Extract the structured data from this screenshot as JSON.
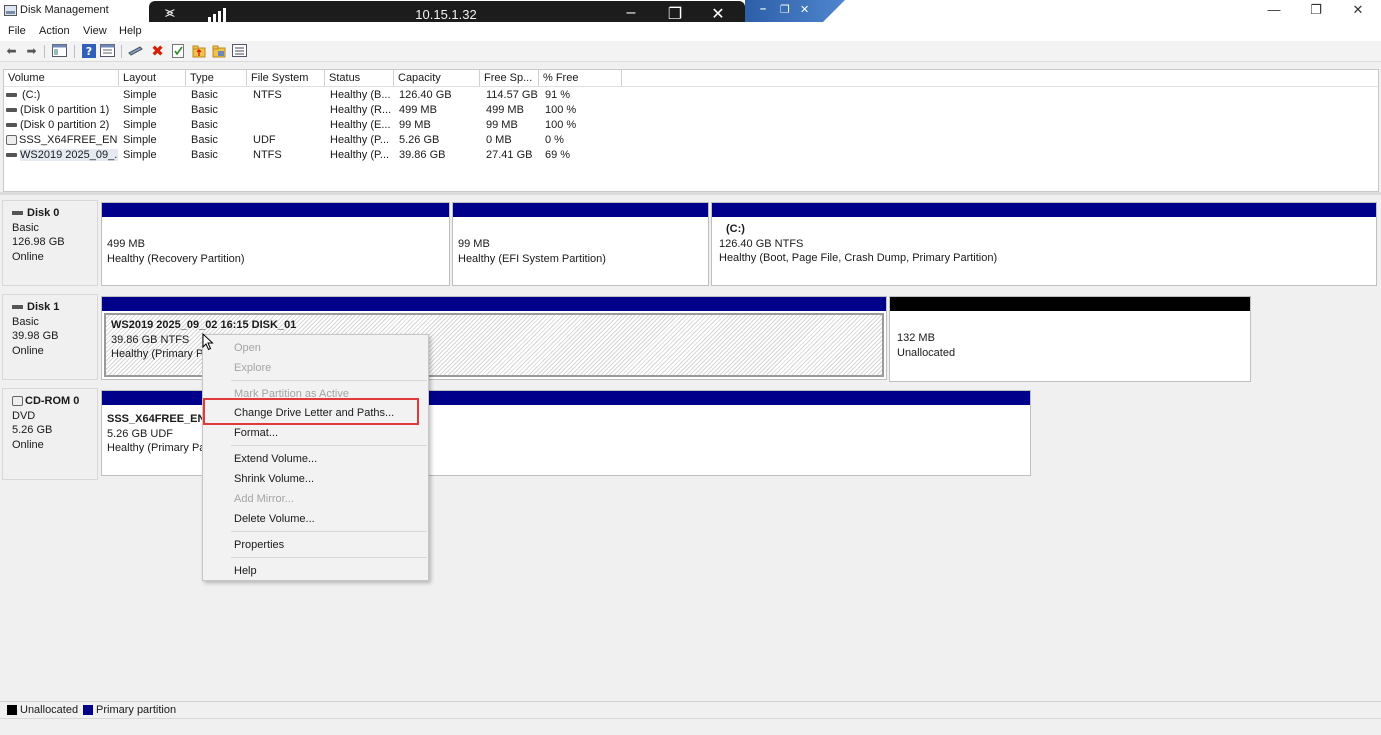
{
  "window": {
    "title": "Disk Management",
    "minimize": "—",
    "maximize": "❐",
    "close": "✕"
  },
  "remote_bar": {
    "ip": "10.15.1.32",
    "pin_glyph": "⪤",
    "minimize": "–",
    "restore": "❐",
    "close": "✕"
  },
  "inner_caption": {
    "minimize": "–",
    "restore": "❐",
    "close": "✕"
  },
  "menu": [
    "File",
    "Action",
    "View",
    "Help"
  ],
  "toolbar": {
    "back": "⬅",
    "forward": "➡",
    "delete": "✖"
  },
  "volume_list": {
    "columns": [
      "Volume",
      "Layout",
      "Type",
      "File System",
      "Status",
      "Capacity",
      "Free Sp...",
      "% Free"
    ],
    "rows": [
      [
        "(C:)",
        "Simple",
        "Basic",
        "NTFS",
        "Healthy (B...",
        "126.40 GB",
        "114.57 GB",
        "91 %"
      ],
      [
        "(Disk 0 partition 1)",
        "Simple",
        "Basic",
        "",
        "Healthy (R...",
        "499 MB",
        "499 MB",
        "100 %"
      ],
      [
        "(Disk 0 partition 2)",
        "Simple",
        "Basic",
        "",
        "Healthy (E...",
        "99 MB",
        "99 MB",
        "100 %"
      ],
      [
        "SSS_X64FREE_EN-...",
        "Simple",
        "Basic",
        "UDF",
        "Healthy (P...",
        "5.26 GB",
        "0 MB",
        "0 %"
      ],
      [
        "WS2019 2025_09_...",
        "Simple",
        "Basic",
        "NTFS",
        "Healthy (P...",
        "39.86 GB",
        "27.41 GB",
        "69 %"
      ]
    ]
  },
  "disks": {
    "disk0": {
      "name": "Disk 0",
      "type": "Basic",
      "size": "126.98 GB",
      "state": "Online",
      "partitions": [
        {
          "line1": "499 MB",
          "line2": "Healthy (Recovery Partition)"
        },
        {
          "line1": "99 MB",
          "line2": "Healthy (EFI System Partition)"
        },
        {
          "title": "(C:)",
          "line1": "126.40 GB NTFS",
          "line2": "Healthy (Boot, Page File, Crash Dump, Primary Partition)"
        }
      ]
    },
    "disk1": {
      "name": "Disk 1",
      "type": "Basic",
      "size": "39.98 GB",
      "state": "Online",
      "partitions": [
        {
          "title": "WS2019 2025_09_02 16:15 DISK_01",
          "line1": "39.86 GB NTFS",
          "line2": "Healthy (Primary Pa"
        },
        {
          "line1": "132 MB",
          "line2": "Unallocated"
        }
      ]
    },
    "cdrom0": {
      "name": "CD-ROM 0",
      "type": "DVD",
      "size": "5.26 GB",
      "state": "Online",
      "partitions": [
        {
          "title": "SSS_X64FREE_EN-U",
          "line1": "5.26 GB UDF",
          "line2": "Healthy (Primary Pa"
        }
      ]
    }
  },
  "context_menu": {
    "open": "Open",
    "explore": "Explore",
    "mark_active": "Mark Partition as Active",
    "change_letter": "Change Drive Letter and Paths...",
    "format": "Format...",
    "extend": "Extend Volume...",
    "shrink": "Shrink Volume...",
    "add_mirror": "Add Mirror...",
    "delete": "Delete Volume...",
    "properties": "Properties",
    "help": "Help"
  },
  "legend": {
    "unallocated": "Unallocated",
    "primary": "Primary partition",
    "unallocated_color": "#000000",
    "primary_color": "#00008b"
  }
}
